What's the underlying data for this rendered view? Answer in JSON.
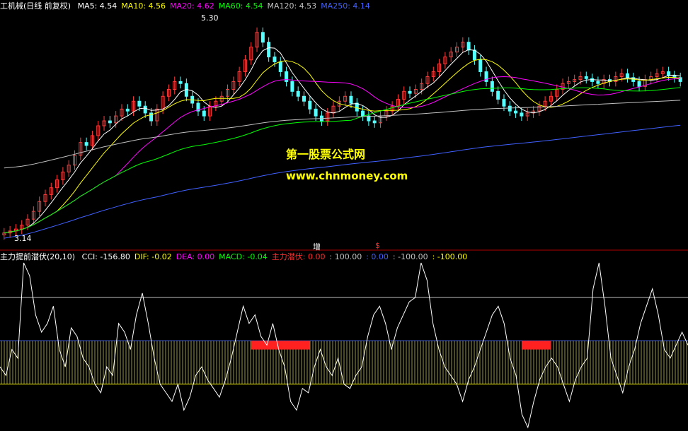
{
  "main_header": {
    "title": "工机械(日线 前复权)",
    "indicators": [
      {
        "label": "MA5: 4.54",
        "color": "#ffffff"
      },
      {
        "label": "MA10: 4.56",
        "color": "#ffff00"
      },
      {
        "label": "MA20: 4.62",
        "color": "#ff00ff"
      },
      {
        "label": "MA60: 4.54",
        "color": "#00ff00"
      },
      {
        "label": "MA120: 4.53",
        "color": "#c0c0c0"
      },
      {
        "label": "MA250: 4.14",
        "color": "#4060ff"
      }
    ]
  },
  "indicator_header": {
    "title": "主力提前潜伏(20,10)",
    "items": [
      {
        "label": "CCI: -156.80",
        "color": "#ffffff"
      },
      {
        "label": "DIF: -0.02",
        "color": "#ffff00"
      },
      {
        "label": "DEA: 0.00",
        "color": "#ff00ff"
      },
      {
        "label": "MACD: -0.04",
        "color": "#00ff00"
      },
      {
        "label": "主力潜伏: 0.00",
        "color": "#ff3030"
      },
      {
        "label": ": 100.00",
        "color": "#c0c0c0"
      },
      {
        "label": ": 0.00",
        "color": "#4060ff"
      },
      {
        "label": ": -100.00",
        "color": "#c0c0c0"
      },
      {
        "label": ": -100.00",
        "color": "#ffff00"
      }
    ]
  },
  "watermark": {
    "line1": "第一股票公式网",
    "line2": "www.chnmoney.com"
  },
  "price_annotations": {
    "high": "5.30",
    "low": "3.14"
  },
  "event_marks": [
    {
      "text": "增",
      "color": "#ffffff"
    },
    {
      "text": "$",
      "color": "#ff3030"
    }
  ],
  "colors": {
    "up": "#ff3b3b",
    "down": "#54ffff",
    "separator": "#b00000",
    "bg": "#000000"
  },
  "chart_data": [
    {
      "type": "candlestick",
      "title": "工机械(日线 前复权)",
      "ylim": [
        3.05,
        5.4
      ],
      "close": [
        3.16,
        3.18,
        3.2,
        3.24,
        3.3,
        3.38,
        3.48,
        3.55,
        3.62,
        3.7,
        3.78,
        3.85,
        3.95,
        4.08,
        4.05,
        4.15,
        4.25,
        4.3,
        4.28,
        4.35,
        4.42,
        4.4,
        4.5,
        4.45,
        4.38,
        4.3,
        4.42,
        4.55,
        4.62,
        4.7,
        4.68,
        4.55,
        4.48,
        4.4,
        4.35,
        4.45,
        4.5,
        4.55,
        4.62,
        4.7,
        4.8,
        4.92,
        5.05,
        5.2,
        5.1,
        4.95,
        4.9,
        4.8,
        4.7,
        4.6,
        4.55,
        4.5,
        4.42,
        4.35,
        4.3,
        4.38,
        4.45,
        4.5,
        4.55,
        4.48,
        4.4,
        4.35,
        4.3,
        4.28,
        4.35,
        4.4,
        4.45,
        4.52,
        4.6,
        4.58,
        4.62,
        4.68,
        4.75,
        4.8,
        4.88,
        4.95,
        5.0,
        5.05,
        5.1,
        5.02,
        4.92,
        4.8,
        4.7,
        4.6,
        4.52,
        4.45,
        4.4,
        4.38,
        4.35,
        4.38,
        4.4,
        4.45,
        4.5,
        4.55,
        4.62,
        4.68,
        4.7,
        4.72,
        4.75,
        4.73,
        4.7,
        4.68,
        4.72,
        4.7,
        4.75,
        4.78,
        4.74,
        4.7,
        4.65,
        4.72,
        4.75,
        4.78,
        4.8,
        4.76,
        4.74,
        4.7
      ],
      "ma": {
        "MA5": 4.54,
        "MA10": 4.56,
        "MA20": 4.62,
        "MA60": 4.54,
        "MA120": 4.53,
        "MA250": 4.14
      },
      "annotations": {
        "high": 5.3,
        "low": 3.14
      }
    },
    {
      "type": "line",
      "title": "主力提前潜伏(20,10)",
      "reference_lines": [
        100,
        0,
        -100
      ],
      "cci_values": [
        -60,
        -80,
        -20,
        -40,
        180,
        150,
        60,
        20,
        40,
        80,
        -20,
        -60,
        30,
        10,
        -40,
        -60,
        -100,
        -120,
        -60,
        -80,
        40,
        20,
        -20,
        60,
        110,
        40,
        -40,
        -100,
        -120,
        -140,
        -100,
        -160,
        -130,
        -80,
        -60,
        -90,
        -110,
        -130,
        -90,
        -40,
        20,
        80,
        40,
        60,
        10,
        -10,
        40,
        -20,
        -60,
        -140,
        -160,
        -110,
        -120,
        -60,
        -20,
        -60,
        -80,
        -40,
        -100,
        -110,
        -80,
        -60,
        10,
        60,
        80,
        40,
        -20,
        30,
        60,
        90,
        100,
        180,
        140,
        40,
        -20,
        -60,
        -80,
        -100,
        -140,
        -90,
        -60,
        -20,
        20,
        60,
        80,
        40,
        -40,
        -80,
        -170,
        -200,
        -140,
        -90,
        -60,
        -40,
        -60,
        -100,
        -140,
        -90,
        -60,
        -40,
        120,
        180,
        80,
        -40,
        -80,
        -120,
        -60,
        -20,
        40,
        80,
        120,
        60,
        -20,
        -40,
        -10,
        20,
        -10
      ],
      "signal_ranges": [
        [
          42,
          52
        ],
        [
          88,
          93
        ]
      ]
    }
  ]
}
